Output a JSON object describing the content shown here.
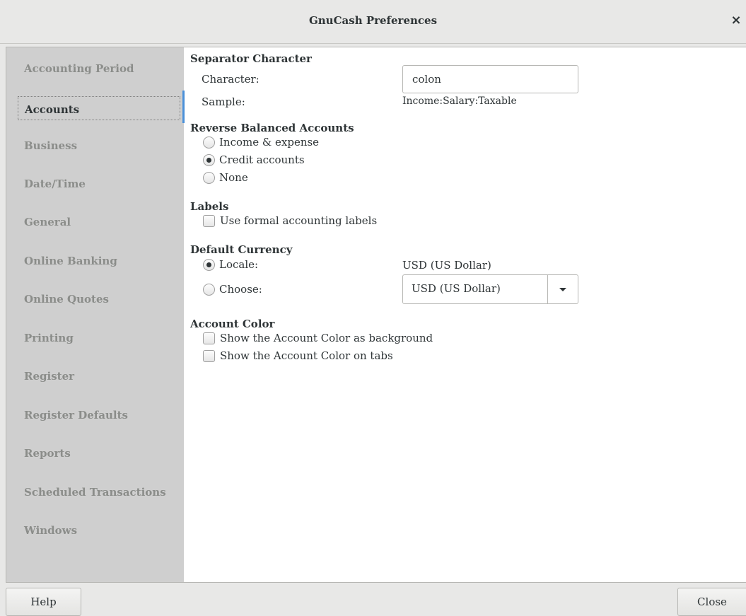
{
  "window": {
    "title": "GnuCash Preferences",
    "close_glyph": "×"
  },
  "sidebar": {
    "tabs": [
      "Accounting Period",
      "Accounts",
      "Business",
      "Date/Time",
      "General",
      "Online Banking",
      "Online Quotes",
      "Printing",
      "Register",
      "Register Defaults",
      "Reports",
      "Scheduled Transactions",
      "Windows"
    ],
    "active": "Accounts"
  },
  "separator": {
    "heading": "Separator Character",
    "character_label": "Character:",
    "character_value": "colon",
    "sample_label": "Sample:",
    "sample_value": "Income:Salary:Taxable"
  },
  "reverse": {
    "heading": "Reverse Balanced Accounts",
    "options": [
      "Income & expense",
      "Credit accounts",
      "None"
    ],
    "selected": "Credit accounts"
  },
  "labels": {
    "heading": "Labels",
    "formal_label": "Use formal accounting labels",
    "formal_checked": false
  },
  "currency": {
    "heading": "Default Currency",
    "locale_label": "Locale:",
    "locale_value": "USD (US Dollar)",
    "choose_label": "Choose:",
    "choose_value": "USD (US Dollar)",
    "selected": "Locale"
  },
  "account_color": {
    "heading": "Account Color",
    "background_label": "Show the Account Color as background",
    "tabs_label": "Show the Account Color on tabs"
  },
  "footer": {
    "help_label": "Help",
    "close_label": "Close"
  },
  "colors": {
    "accent": "#4a90d9",
    "sidebar_bg": "#cfcfcf",
    "inactive_tab": "#8b8d8a"
  }
}
